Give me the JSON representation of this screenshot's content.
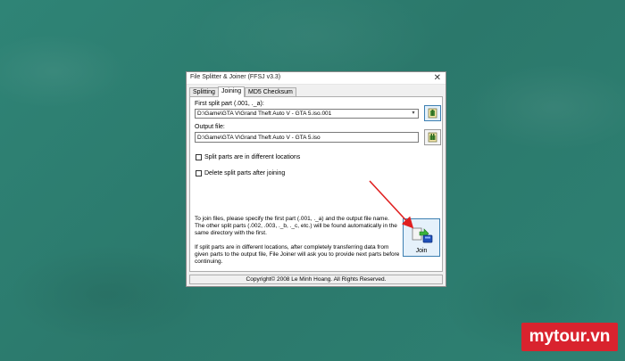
{
  "window": {
    "title": "File Splitter & Joiner (FFSJ v3.3)",
    "close_glyph": "✕"
  },
  "tabs": [
    {
      "label": "Splitting",
      "active": false
    },
    {
      "label": "Joining",
      "active": true
    },
    {
      "label": "MD5 Checksum",
      "active": false
    }
  ],
  "first_part": {
    "label": "First split part (.001, ._a):",
    "value": "D:\\Game\\GTA V\\Grand Theft Auto V - GTA 5.iso.001",
    "dropdown_glyph": "▾"
  },
  "output": {
    "label": "Output file:",
    "value": "D:\\Game\\GTA V\\Grand Theft Auto V - GTA 5.iso"
  },
  "options": {
    "different_locations": "Split parts are in different locations",
    "delete_after": "Delete split parts after joining"
  },
  "info": {
    "para1": "To join files, please specify the first part (.001, ._a) and the output file name. The other split parts (.002, .003, ._b, ._c, etc.) will be found automatically in the same directory with the first.",
    "para2": "If split parts are in different locations, after completely transferring data from given parts to the output file, File Joiner will ask you to provide next parts before continuing."
  },
  "join_button": {
    "label": "Join"
  },
  "status": {
    "text": "Copyright© 2008 Le Minh Hoang. All Rights Reserved."
  },
  "brand": {
    "text": "mytour.vn"
  },
  "colors": {
    "background": "#2e7f72",
    "accent_border": "#3c7fb1",
    "arrow": "#e02020",
    "brand": "#d9232e"
  },
  "icons": {
    "browse_first": "open-folder-icon",
    "browse_output": "save-folder-icon",
    "join": "join-files-icon"
  }
}
